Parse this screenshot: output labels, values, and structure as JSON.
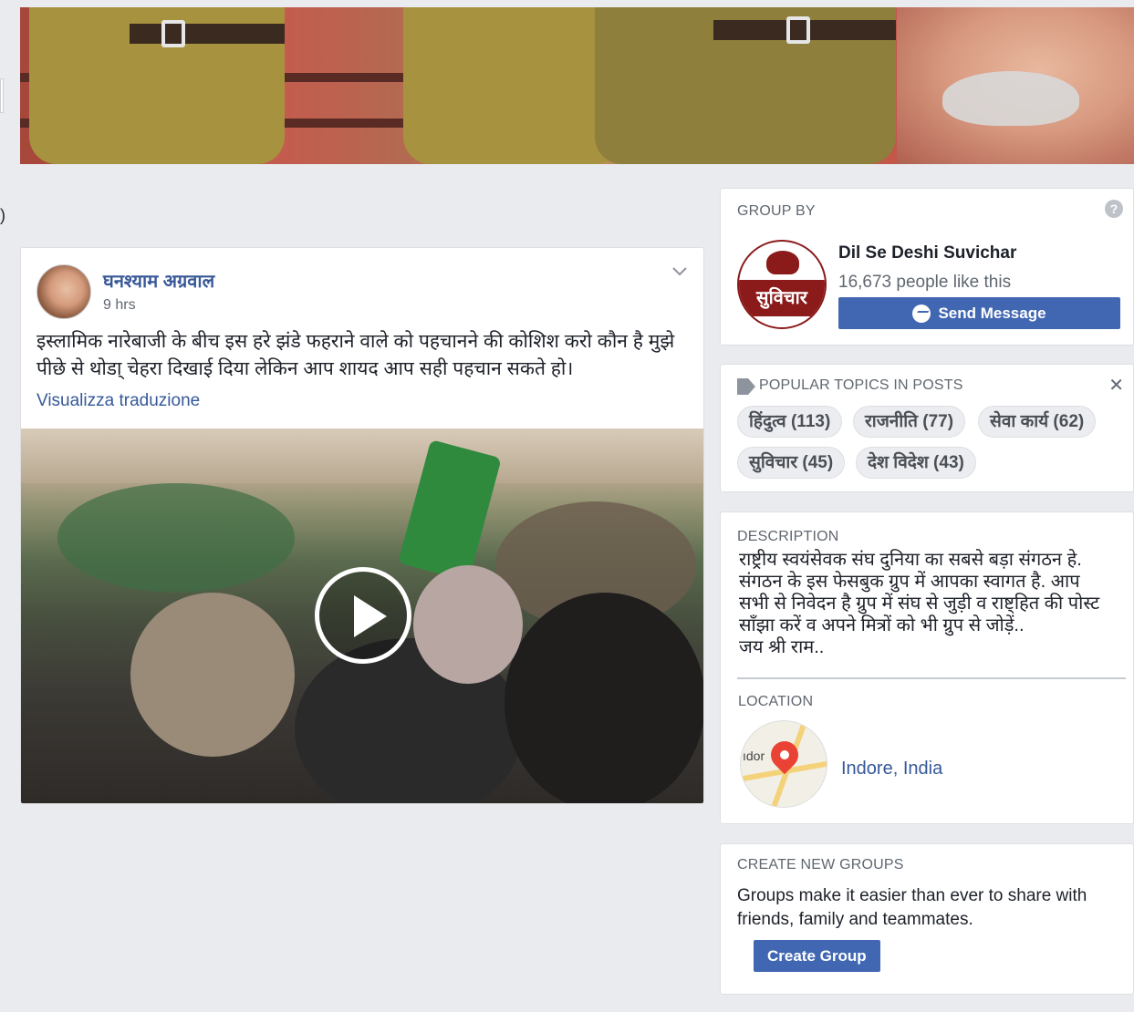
{
  "post": {
    "author": "घनश्याम अग्रवाल",
    "time": "9 hrs",
    "text": "इस्लामिक नारेबाजी के बीच इस हरे झंडे फहराने वाले को पहचानने की कोशिश करो कौन है मुझे पीछे से थोडा् चेहरा दिखाई दिया लेकिन आप शायद आप सही पहचान सकते हो।",
    "translate_link": "Visualizza traduzione",
    "chevron_icon": "chevron-down-icon",
    "video_icon": "play-icon"
  },
  "left_paren": ")",
  "group_by": {
    "title": "GROUP BY",
    "help": "?",
    "page_name": "Dil Se Deshi Suvichar",
    "likes": "16,673 people like this",
    "send_button": "Send Message",
    "logo_text": "सुविचार"
  },
  "topics": {
    "title": "POPULAR TOPICS IN POSTS",
    "close": "✕",
    "items": [
      "हिंदुत्व (113)",
      "राजनीति (77)",
      "सेवा कार्य (62)",
      "सुविचार (45)",
      "देश विदेश (43)"
    ]
  },
  "description": {
    "title": "DESCRIPTION",
    "lines": [
      "राष्ट्रीय स्वयंसेवक संघ दुनिया का सबसे बड़ा संगठन हे.",
      "संगठन के इस फेसबुक ग्रुप में आपका स्वागत है. आप",
      "सभी से निवेदन है ग्रुप में संघ से जुड़ी व राष्ट्हित की पोस्ट",
      "साँझा करें व अपने मित्रों को भी ग्रुप से जोड़ें..",
      "जय श्री राम.."
    ]
  },
  "location": {
    "title": "LOCATION",
    "map_text": "ıdor",
    "name": "Indore, India"
  },
  "create_groups": {
    "title": "CREATE NEW GROUPS",
    "text": "Groups make it easier than ever to share with friends, family and teammates.",
    "button": "Create Group"
  }
}
